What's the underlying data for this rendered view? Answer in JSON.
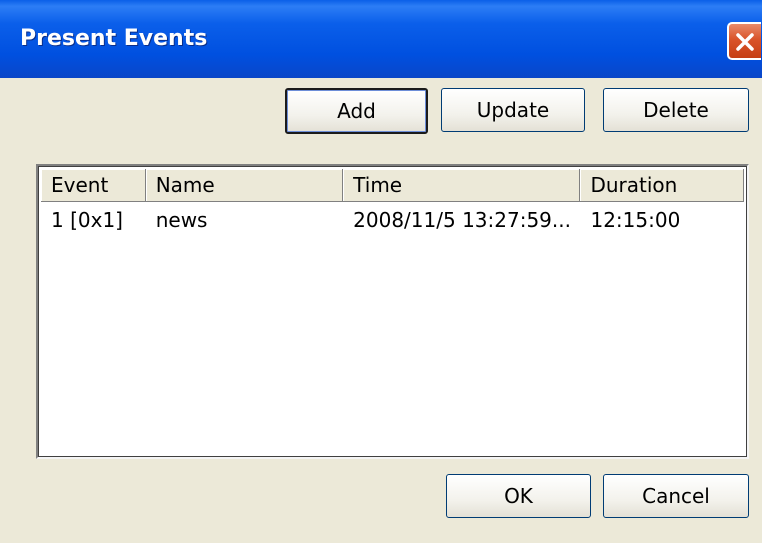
{
  "window": {
    "title": "Present Events"
  },
  "toolbar": {
    "add_label": "Add",
    "update_label": "Update",
    "delete_label": "Delete"
  },
  "list": {
    "columns": [
      "Event",
      "Name",
      "Time",
      "Duration"
    ],
    "rows": [
      {
        "event": "1 [0x1]",
        "name": "news",
        "time": "2008/11/5 13:27:59...",
        "duration": "12:15:00"
      }
    ]
  },
  "footer": {
    "ok_label": "OK",
    "cancel_label": "Cancel"
  },
  "colors": {
    "titlebar": "#0050e0",
    "dialog_bg": "#ece9d8",
    "close_button": "#d9542a"
  },
  "icons": {
    "close": "close-icon"
  }
}
